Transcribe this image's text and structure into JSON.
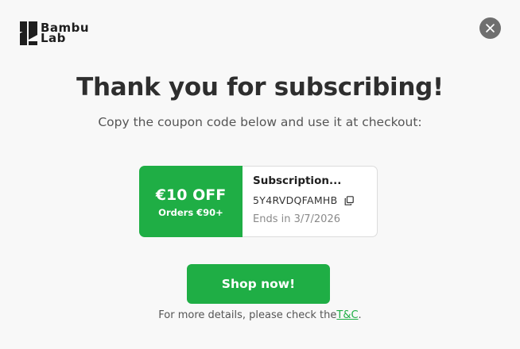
{
  "brand": {
    "logo_line1": "Bambu",
    "logo_line2": "Lab",
    "accent_color": "#1fae45"
  },
  "close": {
    "icon": "close-icon"
  },
  "heading": {
    "title": "Thank you for subscribing!",
    "subtitle": "Copy the coupon code below and use it at checkout:"
  },
  "coupon": {
    "amount": "€10 OFF",
    "minimum": "Orders €90+",
    "name": "Subscription...",
    "code": "5Y4RVDQFAMHB",
    "copy_icon": "copy-icon",
    "expiry": "Ends in 3/7/2026"
  },
  "cta": {
    "label": "Shop now!"
  },
  "footer": {
    "text": "For more details, please check the",
    "link_label": "T&C",
    "suffix": "."
  }
}
